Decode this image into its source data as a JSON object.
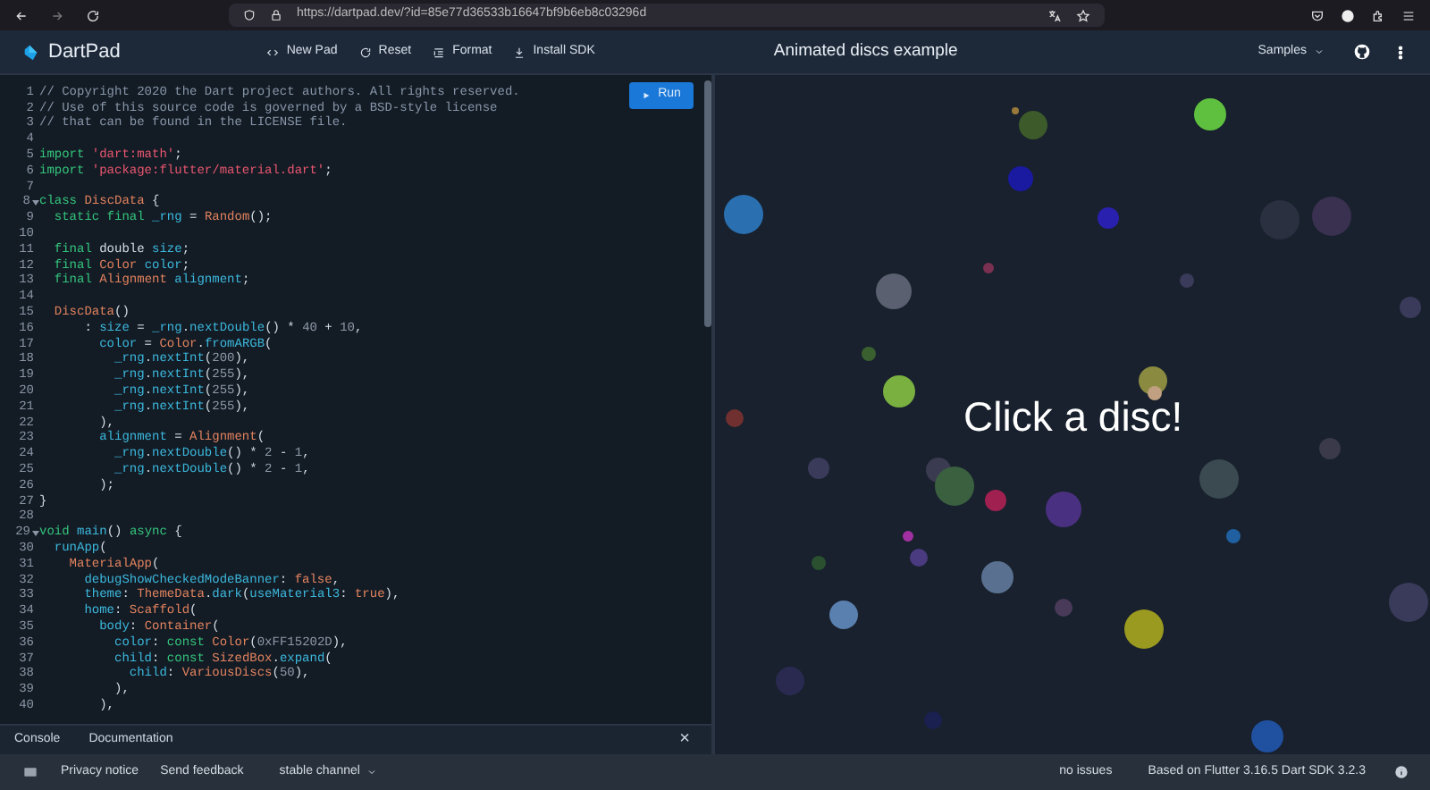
{
  "browser": {
    "url": "https://dartpad.dev/?id=85e77d36533b16647bf9b6eb8c03296d"
  },
  "app_bar": {
    "logo_text": "DartPad",
    "actions": [
      {
        "kind": "code",
        "label": "New Pad"
      },
      {
        "kind": "reset",
        "label": "Reset"
      },
      {
        "kind": "format",
        "label": "Format"
      },
      {
        "kind": "download",
        "label": "Install SDK"
      }
    ],
    "title": "Animated discs example",
    "samples": "Samples"
  },
  "run_button": "Run",
  "editor": {
    "lines": [
      {
        "number": "1",
        "foldable": false,
        "tokens": [
          {
            "kind": "comment",
            "text": "// Copyright 2020 the Dart project authors. All rights reserved."
          }
        ]
      },
      {
        "number": "2",
        "foldable": false,
        "tokens": [
          {
            "kind": "comment",
            "text": "// Use of this source code is governed by a BSD-style license"
          }
        ]
      },
      {
        "number": "3",
        "foldable": false,
        "tokens": [
          {
            "kind": "comment",
            "text": "// that can be found in the LICENSE file."
          }
        ]
      },
      {
        "number": "4",
        "foldable": false
      },
      {
        "number": "5",
        "foldable": false,
        "tokens": [
          {
            "kind": "keyword",
            "text": "import "
          },
          {
            "kind": "string",
            "text": "'dart:math'"
          },
          {
            "kind": "plain",
            "text": ";"
          }
        ]
      },
      {
        "number": "6",
        "foldable": false,
        "tokens": [
          {
            "kind": "keyword",
            "text": "import "
          },
          {
            "kind": "string",
            "text": "'package:flutter/material.dart'"
          },
          {
            "kind": "plain",
            "text": ";"
          }
        ]
      },
      {
        "number": "7",
        "foldable": false
      },
      {
        "number": "8",
        "foldable": true,
        "tokens": [
          {
            "kind": "keyword",
            "text": "class "
          },
          {
            "kind": "type",
            "text": "DiscData"
          },
          {
            "kind": "plain",
            "text": " {"
          }
        ]
      },
      {
        "number": "9",
        "foldable": false,
        "tokens": [
          {
            "kind": "keyword",
            "text": "  static final "
          },
          {
            "kind": "ident",
            "text": "_rng"
          },
          {
            "kind": "plain",
            "text": " = "
          },
          {
            "kind": "type",
            "text": "Random"
          },
          {
            "kind": "plain",
            "text": "();"
          }
        ]
      },
      {
        "number": "10",
        "foldable": false
      },
      {
        "number": "11",
        "foldable": false,
        "tokens": [
          {
            "kind": "keyword",
            "text": "  final "
          },
          {
            "kind": "plain",
            "text": "double "
          },
          {
            "kind": "ident",
            "text": "size"
          },
          {
            "kind": "plain",
            "text": ";"
          }
        ]
      },
      {
        "number": "12",
        "foldable": false,
        "tokens": [
          {
            "kind": "keyword",
            "text": "  final "
          },
          {
            "kind": "type",
            "text": "Color "
          },
          {
            "kind": "ident",
            "text": "color"
          },
          {
            "kind": "plain",
            "text": ";"
          }
        ]
      },
      {
        "number": "13",
        "foldable": false,
        "tokens": [
          {
            "kind": "keyword",
            "text": "  final "
          },
          {
            "kind": "type",
            "text": "Alignment "
          },
          {
            "kind": "ident",
            "text": "alignment"
          },
          {
            "kind": "plain",
            "text": ";"
          }
        ]
      },
      {
        "number": "14",
        "foldable": false
      },
      {
        "number": "15",
        "foldable": false,
        "tokens": [
          {
            "kind": "type",
            "text": "  DiscData"
          },
          {
            "kind": "plain",
            "text": "()"
          }
        ]
      },
      {
        "number": "16",
        "foldable": false,
        "tokens": [
          {
            "kind": "plain",
            "text": "      : "
          },
          {
            "kind": "ident",
            "text": "size"
          },
          {
            "kind": "plain",
            "text": " = "
          },
          {
            "kind": "ident",
            "text": "_rng"
          },
          {
            "kind": "plain",
            "text": "."
          },
          {
            "kind": "ident",
            "text": "nextDouble"
          },
          {
            "kind": "plain",
            "text": "() * "
          },
          {
            "kind": "number",
            "text": "40"
          },
          {
            "kind": "plain",
            "text": " + "
          },
          {
            "kind": "number",
            "text": "10"
          },
          {
            "kind": "plain",
            "text": ","
          }
        ]
      },
      {
        "number": "17",
        "foldable": false,
        "tokens": [
          {
            "kind": "ident",
            "text": "        color"
          },
          {
            "kind": "plain",
            "text": " = "
          },
          {
            "kind": "type",
            "text": "Color"
          },
          {
            "kind": "plain",
            "text": "."
          },
          {
            "kind": "ident",
            "text": "fromARGB"
          },
          {
            "kind": "plain",
            "text": "("
          }
        ]
      },
      {
        "number": "18",
        "foldable": false,
        "tokens": [
          {
            "kind": "ident",
            "text": "          _rng"
          },
          {
            "kind": "plain",
            "text": "."
          },
          {
            "kind": "ident",
            "text": "nextInt"
          },
          {
            "kind": "plain",
            "text": "("
          },
          {
            "kind": "number",
            "text": "200"
          },
          {
            "kind": "plain",
            "text": "),"
          }
        ]
      },
      {
        "number": "19",
        "foldable": false,
        "tokens": [
          {
            "kind": "ident",
            "text": "          _rng"
          },
          {
            "kind": "plain",
            "text": "."
          },
          {
            "kind": "ident",
            "text": "nextInt"
          },
          {
            "kind": "plain",
            "text": "("
          },
          {
            "kind": "number",
            "text": "255"
          },
          {
            "kind": "plain",
            "text": "),"
          }
        ]
      },
      {
        "number": "20",
        "foldable": false,
        "tokens": [
          {
            "kind": "ident",
            "text": "          _rng"
          },
          {
            "kind": "plain",
            "text": "."
          },
          {
            "kind": "ident",
            "text": "nextInt"
          },
          {
            "kind": "plain",
            "text": "("
          },
          {
            "kind": "number",
            "text": "255"
          },
          {
            "kind": "plain",
            "text": "),"
          }
        ]
      },
      {
        "number": "21",
        "foldable": false,
        "tokens": [
          {
            "kind": "ident",
            "text": "          _rng"
          },
          {
            "kind": "plain",
            "text": "."
          },
          {
            "kind": "ident",
            "text": "nextInt"
          },
          {
            "kind": "plain",
            "text": "("
          },
          {
            "kind": "number",
            "text": "255"
          },
          {
            "kind": "plain",
            "text": "),"
          }
        ]
      },
      {
        "number": "22",
        "foldable": false,
        "tokens": [
          {
            "kind": "plain",
            "text": "        ),"
          }
        ]
      },
      {
        "number": "23",
        "foldable": false,
        "tokens": [
          {
            "kind": "ident",
            "text": "        alignment"
          },
          {
            "kind": "plain",
            "text": " = "
          },
          {
            "kind": "type",
            "text": "Alignment"
          },
          {
            "kind": "plain",
            "text": "("
          }
        ]
      },
      {
        "number": "24",
        "foldable": false,
        "tokens": [
          {
            "kind": "ident",
            "text": "          _rng"
          },
          {
            "kind": "plain",
            "text": "."
          },
          {
            "kind": "ident",
            "text": "nextDouble"
          },
          {
            "kind": "plain",
            "text": "() * "
          },
          {
            "kind": "number",
            "text": "2"
          },
          {
            "kind": "plain",
            "text": " - "
          },
          {
            "kind": "number",
            "text": "1"
          },
          {
            "kind": "plain",
            "text": ","
          }
        ]
      },
      {
        "number": "25",
        "foldable": false,
        "tokens": [
          {
            "kind": "ident",
            "text": "          _rng"
          },
          {
            "kind": "plain",
            "text": "."
          },
          {
            "kind": "ident",
            "text": "nextDouble"
          },
          {
            "kind": "plain",
            "text": "() * "
          },
          {
            "kind": "number",
            "text": "2"
          },
          {
            "kind": "plain",
            "text": " - "
          },
          {
            "kind": "number",
            "text": "1"
          },
          {
            "kind": "plain",
            "text": ","
          }
        ]
      },
      {
        "number": "26",
        "foldable": false,
        "tokens": [
          {
            "kind": "plain",
            "text": "        );"
          }
        ]
      },
      {
        "number": "27",
        "foldable": false,
        "tokens": [
          {
            "kind": "plain",
            "text": "}"
          }
        ]
      },
      {
        "number": "28",
        "foldable": false
      },
      {
        "number": "29",
        "foldable": true,
        "tokens": [
          {
            "kind": "keyword",
            "text": "void "
          },
          {
            "kind": "ident",
            "text": "main"
          },
          {
            "kind": "plain",
            "text": "() "
          },
          {
            "kind": "keyword",
            "text": "async"
          },
          {
            "kind": "plain",
            "text": " {"
          }
        ]
      },
      {
        "number": "30",
        "foldable": false,
        "tokens": [
          {
            "kind": "ident",
            "text": "  runApp"
          },
          {
            "kind": "plain",
            "text": "("
          }
        ]
      },
      {
        "number": "31",
        "foldable": false,
        "tokens": [
          {
            "kind": "type",
            "text": "    MaterialApp"
          },
          {
            "kind": "plain",
            "text": "("
          }
        ]
      },
      {
        "number": "32",
        "foldable": false,
        "tokens": [
          {
            "kind": "ident",
            "text": "      debugShowCheckedModeBanner"
          },
          {
            "kind": "plain",
            "text": ": "
          },
          {
            "kind": "type",
            "text": "false"
          },
          {
            "kind": "plain",
            "text": ","
          }
        ]
      },
      {
        "number": "33",
        "foldable": false,
        "tokens": [
          {
            "kind": "ident",
            "text": "      theme"
          },
          {
            "kind": "plain",
            "text": ": "
          },
          {
            "kind": "type",
            "text": "ThemeData"
          },
          {
            "kind": "plain",
            "text": "."
          },
          {
            "kind": "ident",
            "text": "dark"
          },
          {
            "kind": "plain",
            "text": "("
          },
          {
            "kind": "ident",
            "text": "useMaterial3"
          },
          {
            "kind": "plain",
            "text": ": "
          },
          {
            "kind": "type",
            "text": "true"
          },
          {
            "kind": "plain",
            "text": "),"
          }
        ]
      },
      {
        "number": "34",
        "foldable": false,
        "tokens": [
          {
            "kind": "ident",
            "text": "      home"
          },
          {
            "kind": "plain",
            "text": ": "
          },
          {
            "kind": "type",
            "text": "Scaffold"
          },
          {
            "kind": "plain",
            "text": "("
          }
        ]
      },
      {
        "number": "35",
        "foldable": false,
        "tokens": [
          {
            "kind": "ident",
            "text": "        body"
          },
          {
            "kind": "plain",
            "text": ": "
          },
          {
            "kind": "type",
            "text": "Container"
          },
          {
            "kind": "plain",
            "text": "("
          }
        ]
      },
      {
        "number": "36",
        "foldable": false,
        "tokens": [
          {
            "kind": "ident",
            "text": "          color"
          },
          {
            "kind": "plain",
            "text": ": "
          },
          {
            "kind": "keyword",
            "text": "const "
          },
          {
            "kind": "type",
            "text": "Color"
          },
          {
            "kind": "plain",
            "text": "("
          },
          {
            "kind": "number",
            "text": "0xFF15202D"
          },
          {
            "kind": "plain",
            "text": "),"
          }
        ]
      },
      {
        "number": "37",
        "foldable": false,
        "tokens": [
          {
            "kind": "ident",
            "text": "          child"
          },
          {
            "kind": "plain",
            "text": ": "
          },
          {
            "kind": "keyword",
            "text": "const "
          },
          {
            "kind": "type",
            "text": "SizedBox"
          },
          {
            "kind": "plain",
            "text": "."
          },
          {
            "kind": "ident",
            "text": "expand"
          },
          {
            "kind": "plain",
            "text": "("
          }
        ]
      },
      {
        "number": "38",
        "foldable": false,
        "tokens": [
          {
            "kind": "ident",
            "text": "            child"
          },
          {
            "kind": "plain",
            "text": ": "
          },
          {
            "kind": "type",
            "text": "VariousDiscs"
          },
          {
            "kind": "plain",
            "text": "("
          },
          {
            "kind": "number",
            "text": "50"
          },
          {
            "kind": "plain",
            "text": "),"
          }
        ]
      },
      {
        "number": "39",
        "foldable": false,
        "tokens": [
          {
            "kind": "plain",
            "text": "          ),"
          }
        ]
      },
      {
        "number": "40",
        "foldable": false,
        "tokens": [
          {
            "kind": "plain",
            "text": "        ),"
          }
        ]
      }
    ]
  },
  "preview": {
    "message": "Click a disc!"
  },
  "console_bar": {
    "tabs": [
      "Console",
      "Documentation"
    ],
    "close": "×"
  },
  "footer": {
    "links": [
      "Privacy notice",
      "Send feedback"
    ],
    "channel": "stable channel",
    "issues": "no issues",
    "version": "Based on Flutter 3.16.5 Dart SDK 3.2.3"
  }
}
